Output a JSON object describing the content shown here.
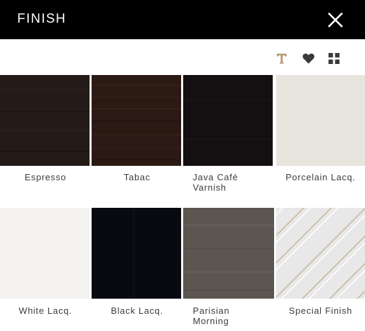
{
  "header": {
    "title": "FINISH",
    "close_icon": "close-icon",
    "background": "#000000",
    "text_color": "#ffffff"
  },
  "toolbar": {
    "icons": [
      "text-icon",
      "heart-icon",
      "grid-icon"
    ],
    "text_icon_color": "#b59a6b",
    "icon_color": "#3a3a3a"
  },
  "finishes": [
    {
      "label": "Espresso",
      "color": "#241a17"
    },
    {
      "label": "Tabac",
      "color": "#2b1a13"
    },
    {
      "label": "Java Café\nVarnish",
      "color": "#140f10"
    },
    {
      "label": "Porcelain Lacq.",
      "color": "#e7e4dd"
    },
    {
      "label": "White Lacq.",
      "color": "#f4f3f1"
    },
    {
      "label": "Black Lacq.",
      "color": "#080a10"
    },
    {
      "label": "Parisian\nMorning",
      "color": "#5b5650"
    },
    {
      "label": "Special Finish",
      "color": "#e8e8e8"
    }
  ]
}
